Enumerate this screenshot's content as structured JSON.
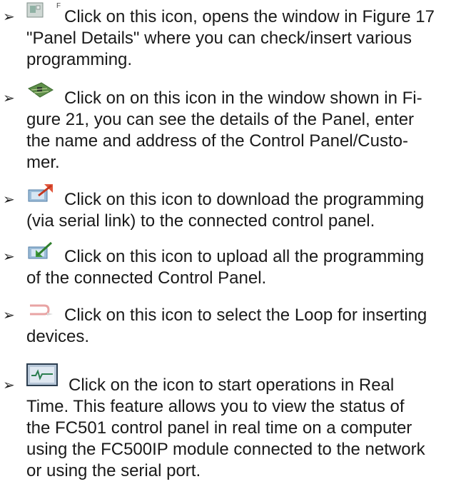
{
  "bullets": [
    {
      "icon": "panel-details-icon",
      "lines": [
        "Click on this icon, opens the window in Figure 17",
        "\"Panel Details\" where you can check/insert various",
        "programming."
      ]
    },
    {
      "icon": "circuit-board-icon",
      "lines": [
        "Click on on this icon in the window shown in Fi-",
        "gure 21, you can see the details of the Panel, enter",
        "the name and address of the Control Panel/Custo-",
        "mer."
      ]
    },
    {
      "icon": "download-icon",
      "lines": [
        "Click on this icon to download the programming",
        "(via serial link) to the connected control panel."
      ]
    },
    {
      "icon": "upload-icon",
      "lines": [
        "Click on this icon to upload all the programming",
        "of the connected Control Panel."
      ]
    },
    {
      "icon": "loop-select-icon",
      "lines": [
        "Click on this icon to select the Loop for inserting",
        "devices."
      ]
    },
    {
      "icon": "real-time-monitor-icon",
      "lines": [
        "Click on the icon to start operations in Real",
        "Time. This feature allows you to view the status of",
        "the FC501 control panel in real time on a computer",
        "using the FC500IP module connected to the network",
        "or using the serial port."
      ]
    }
  ]
}
